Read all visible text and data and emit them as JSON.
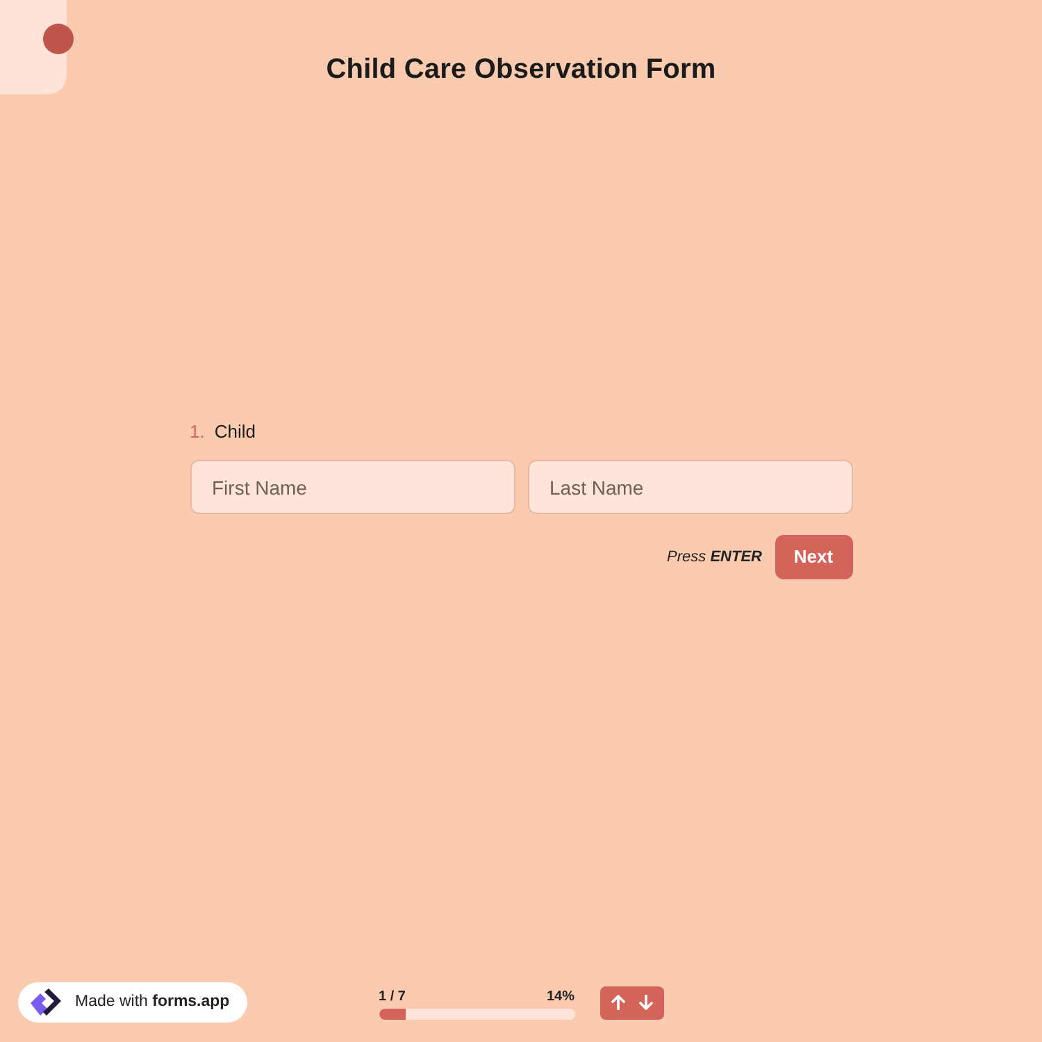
{
  "form": {
    "title": "Child Care Observation Form"
  },
  "question": {
    "number": "1.",
    "label": "Child",
    "fields": [
      {
        "placeholder": "First Name"
      },
      {
        "placeholder": "Last Name"
      }
    ],
    "hint": "Press **ENTER**",
    "button": "Next"
  },
  "progress": {
    "count": "1 / 7",
    "percent": "14%",
    "level": 0.14
  },
  "badge": {
    "text": "Made with **forms.app**"
  }
}
